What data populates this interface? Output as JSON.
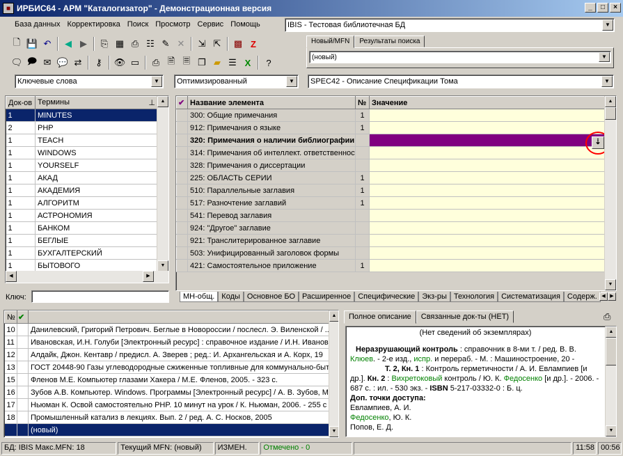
{
  "window": {
    "title": "ИРБИС64 - АРМ \"Каталогизатор\" - Демонстрационная версия"
  },
  "menu": [
    "База данных",
    "Корректировка",
    "Поиск",
    "Просмотр",
    "Сервис",
    "Помощь"
  ],
  "database_combo": "IBIS - Тестовая библиотечная БД",
  "record_tabs": [
    "Новый/MFN",
    "Результаты поиска"
  ],
  "record_combo": "(новый)",
  "search_mode_combo": "Ключевые слова",
  "optimization_combo": "Оптимизированный",
  "worksheet_combo": "SPEC42 - Описание Спецификации Тома",
  "dictionary": {
    "headers": [
      "Док-ов",
      "Термины"
    ],
    "rows": [
      [
        "1",
        "MINUTES"
      ],
      [
        "2",
        "PHP"
      ],
      [
        "1",
        "TEACH"
      ],
      [
        "1",
        "WINDOWS"
      ],
      [
        "1",
        "YOURSELF"
      ],
      [
        "1",
        "АКАД"
      ],
      [
        "1",
        "АКАДЕМИЯ"
      ],
      [
        "1",
        "АЛГОРИТМ"
      ],
      [
        "1",
        "АСТРОНОМИЯ"
      ],
      [
        "1",
        "БАНКОМ"
      ],
      [
        "1",
        "БЕГЛЫЕ"
      ],
      [
        "1",
        "БУХГАЛТЕРСКИЙ"
      ],
      [
        "1",
        "БЫТОВОГО"
      ]
    ],
    "key_label": "Ключ:"
  },
  "fields": {
    "headers": [
      "Название элемента",
      "№",
      "Значение"
    ],
    "rows": [
      [
        "300: Общие примечания",
        "1",
        ""
      ],
      [
        "912: Примечания о языке",
        "1",
        ""
      ],
      [
        "320: Примечания о наличии библиографии",
        "",
        ""
      ],
      [
        "314: Примечания об интеллект. ответственности",
        "",
        ""
      ],
      [
        "328: Примечания о диссертации",
        "",
        ""
      ],
      [
        "225: ОБЛАСТЬ СЕРИИ",
        "1",
        ""
      ],
      [
        "510: Параллельные заглавия",
        "1",
        ""
      ],
      [
        "517: Разночтение заглавий",
        "1",
        ""
      ],
      [
        "541: Перевод заглавия",
        "",
        ""
      ],
      [
        "924: \"Другое\" заглавие",
        "",
        ""
      ],
      [
        "921: Транслитерированное заглавие",
        "",
        ""
      ],
      [
        "503: Унифицированный заголовок формы",
        "",
        ""
      ],
      [
        "421: Самостоятельное приложение",
        "1",
        ""
      ]
    ],
    "tabs": [
      "МН-общ.",
      "Коды",
      "Основное БО",
      "Расширенное",
      "Специфические",
      "Экз-ры",
      "Технология",
      "Систематизация",
      "Содерж."
    ]
  },
  "records": {
    "headers": [
      "№"
    ],
    "rows": [
      [
        "10",
        "Данилевский, Григорий Петрович. Беглые в Новороссии / послесл. Э. Виленской / ..."
      ],
      [
        "11",
        "Ивановская, И.Н. Голуби [Электронный ресурс] : справочное издание / И.Н. Ивановская"
      ],
      [
        "12",
        "Алдайк, Джон. Кентавр / предисл. А. Зверев ; ред.: И. Архангельская и А. Корх, 19"
      ],
      [
        "13",
        "ГОСТ 20448-90 Газы углеводородные сжиженные топливные для коммунально-бытового"
      ],
      [
        "15",
        "Фленов М.Е. Компьютер глазами Хакера / М.Е. Фленов, 2005. - 323 с."
      ],
      [
        "16",
        "Зубов А.В. Компьютер. Windows. Программы [Электронный ресурс] / А. В. Зубов, М"
      ],
      [
        "17",
        "Ньюман К. Освой самостоятельно PHP. 10 минут на урок / К. Ньюман, 2006. - 255 с"
      ],
      [
        "18",
        "Промышленный катализ в лекциях. Вып. 2 / ред. А. С. Носков, 2005"
      ],
      [
        "",
        "(новый)"
      ]
    ]
  },
  "description_tabs": [
    "Полное описание",
    "Связанные док-ты (НЕТ)"
  ],
  "description": {
    "line1": "(Нет сведений об экземплярах)",
    "p1_b": "Неразрушающий контроль",
    "p1_a": " : справочник в 8-ми т. / ред. В. В. ",
    "p1_g1": "Клюев",
    "p1_c": ". - 2-е изд., ",
    "p1_g2": "испр.",
    "p1_d": " и перераб. - М. : Машиностроение, 20 -",
    "p2_b": "Т. 2, Кн. 1",
    "p2_a": " : Контроль герметичности / А. И. Евлампиев [и др.]. ",
    "p2_b2": "Кн. 2",
    "p2_c": " : ",
    "p2_g1": "Вихретоковый",
    "p2_d": " контроль / Ю. К. ",
    "p2_g2": "Федосенко",
    "p2_e": " [и др.]. - 2006. - 687 с. : ил. - 530 экз. - ",
    "p2_b3": "ISBN",
    "p2_f": " 5-217-03332-0 : Б. ц.",
    "p3_b": "Доп. точки доступа:",
    "p3_l1": "Евлампиев, А. И.",
    "p3_g": "Федосенко",
    "p3_l2": ", Ю. К.",
    "p3_l3": "Попов, Е. Д."
  },
  "status": {
    "db": "БД: IBIS Макс.MFN: 18",
    "current": "Текущий MFN: (новый)",
    "changed": "ИЗМЕН.",
    "marked": "Отмечено - 0",
    "time1": "11:58",
    "time2": "00:56"
  },
  "colors": {
    "accent": "#0a246a",
    "highlight_row": "#800080",
    "value_bg": "#ffffdc",
    "annotation": "#ff0000"
  }
}
